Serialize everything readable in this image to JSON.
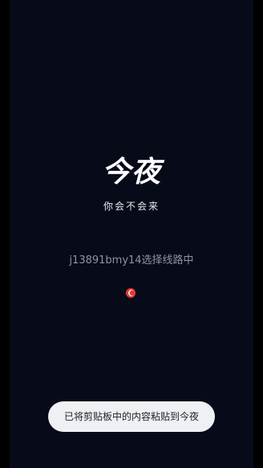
{
  "app": {
    "logo_text": "今夜",
    "slogan": "你会不会来"
  },
  "loading": {
    "status_text": "j13891bmy14选择线路中"
  },
  "toast": {
    "message": "已将剪贴板中的内容粘贴到今夜"
  },
  "colors": {
    "background": "#070b19",
    "spinner_red": "#e53935",
    "toast_bg": "#eef0f4"
  },
  "icons": {
    "spinner": "loading-spinner-icon"
  }
}
